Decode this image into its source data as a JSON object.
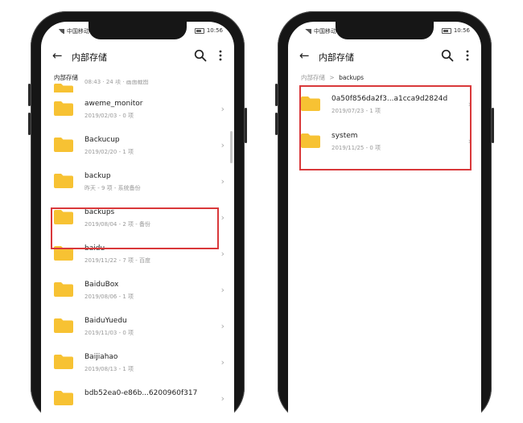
{
  "left_phone": {
    "status": {
      "left": "中国移动 4G",
      "time": "10:56"
    },
    "appbar": {
      "title": "内部存储",
      "back_icon": "arrow-left-icon",
      "search_icon": "search-icon",
      "more_icon": "more-vert-icon"
    },
    "breadcrumb": {
      "current": "内部存储"
    },
    "partial_top_meta": "08:43 · 24 项 · 画面截图",
    "folders": [
      {
        "name": "aweme_monitor",
        "meta": "2019/02/03 - 0 项"
      },
      {
        "name": "Backucup",
        "meta": "2019/02/20 - 1 项"
      },
      {
        "name": "backup",
        "meta": "昨天 - 9 项 - 系统备份"
      },
      {
        "name": "backups",
        "meta": "2019/08/04 - 2 项 - 备份"
      },
      {
        "name": "baidu",
        "meta": "2019/11/22 - 7 项 - 百度"
      },
      {
        "name": "BaiduBox",
        "meta": "2019/08/06 - 1 项"
      },
      {
        "name": "BaiduYuedu",
        "meta": "2019/11/03 - 0 项"
      },
      {
        "name": "Baijiahao",
        "meta": "2019/08/13 - 1 项"
      },
      {
        "name": "bdb52ea0-e86b...6200960f317",
        "meta": ""
      }
    ]
  },
  "right_phone": {
    "status": {
      "left": "中国移动 4G",
      "time": "10:56"
    },
    "appbar": {
      "title": "内部存储",
      "back_icon": "arrow-left-icon",
      "search_icon": "search-icon",
      "more_icon": "more-vert-icon"
    },
    "breadcrumb": {
      "root": "内部存储",
      "separator": ">",
      "current": "backups"
    },
    "folders": [
      {
        "name": "0a50f856da2f3...a1cca9d2824d",
        "meta": "2019/07/23 - 1 项"
      },
      {
        "name": "system",
        "meta": "2019/11/25 - 0 项"
      }
    ]
  },
  "colors": {
    "folder": "#f7c233",
    "highlight": "#d9383a",
    "frame": "#161616"
  }
}
